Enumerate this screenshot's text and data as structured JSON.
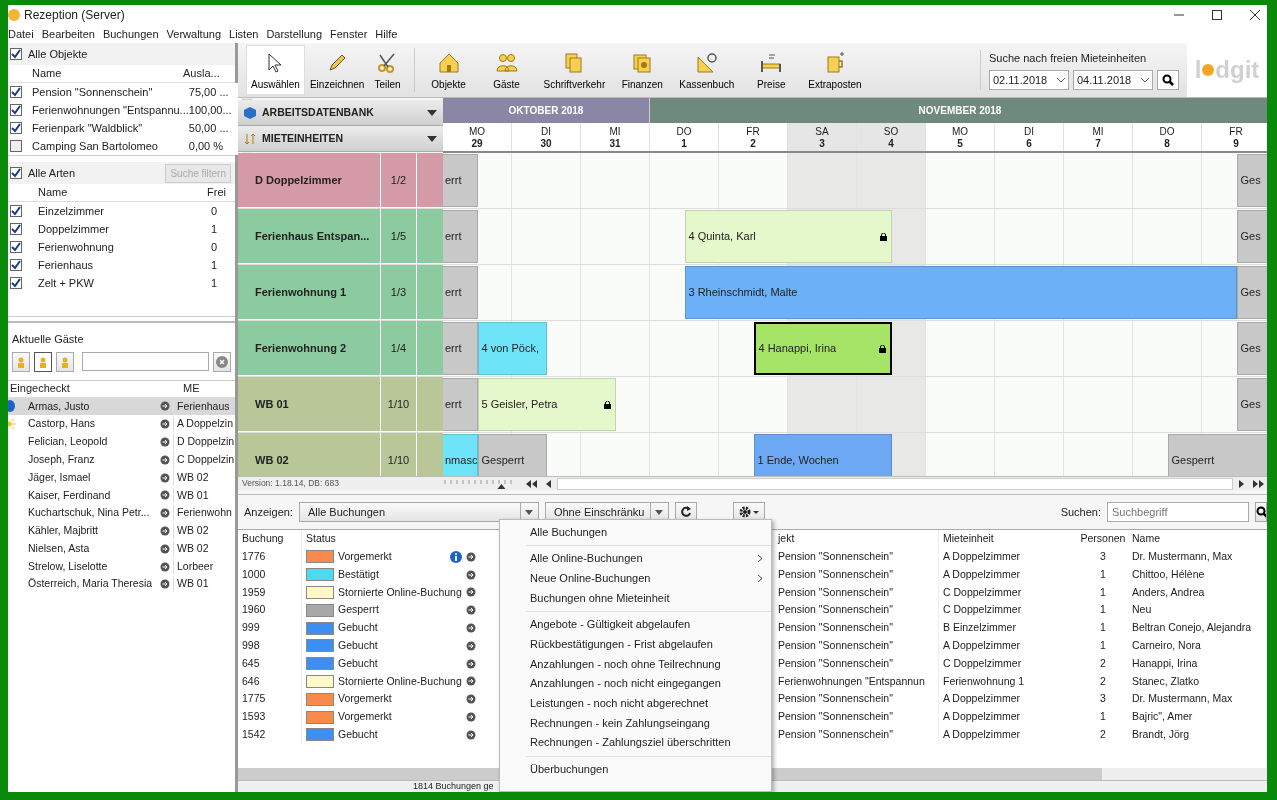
{
  "window": {
    "title": "Rezeption (Server)"
  },
  "menu": [
    "Datei",
    "Bearbeiten",
    "Buchungen",
    "Verwaltung",
    "Listen",
    "Darstellung",
    "Fenster",
    "Hilfe"
  ],
  "objects": {
    "label": "Alle Objekte",
    "checked": true,
    "columns": [
      "Name",
      "Ausla..."
    ],
    "rows": [
      {
        "name": "Pension \"Sonnenschein\"",
        "value": "75,00 ...",
        "checked": true
      },
      {
        "name": "Ferienwohnungen \"Entspannu...",
        "value": "100,00...",
        "checked": true
      },
      {
        "name": "Ferienpark \"Waldblick\"",
        "value": "50,00 ...",
        "checked": true
      },
      {
        "name": "Camping San Bartolomeo",
        "value": "0,00 %",
        "checked": false
      }
    ]
  },
  "types": {
    "label": "Alle Arten",
    "checked": true,
    "filter_button": {
      "label": "Suche filtern",
      "disabled": true
    },
    "columns": [
      "Name",
      "Frei"
    ],
    "rows": [
      {
        "name": "Einzelzimmer",
        "free": "0",
        "checked": true
      },
      {
        "name": "Doppelzimmer",
        "free": "1",
        "checked": true
      },
      {
        "name": "Ferienwohnung",
        "free": "0",
        "checked": true
      },
      {
        "name": "Ferienhaus",
        "free": "1",
        "checked": true
      },
      {
        "name": "Zelt + PKW",
        "free": "1",
        "checked": true
      }
    ]
  },
  "guests": {
    "label": "Aktuelle Gäste",
    "filters": [
      {
        "selected": false
      },
      {
        "selected": true
      },
      {
        "selected": false
      }
    ],
    "columns": [
      "Eingecheckt",
      "ME"
    ],
    "rows": [
      {
        "name": "Armas, Justo",
        "unit": "Ferienhaus",
        "kind": "info",
        "selected": true
      },
      {
        "name": "Castorp, Hans",
        "unit": "A Doppelzin",
        "kind": "new",
        "selected": false
      },
      {
        "name": "Felician, Leopold",
        "unit": "D Doppelzin",
        "kind": "plain",
        "selected": false
      },
      {
        "name": "Joseph, Franz",
        "unit": "C Doppelzin",
        "kind": "plain",
        "selected": false
      },
      {
        "name": "Jäger, Ismael",
        "unit": "WB 02",
        "kind": "plain",
        "selected": false
      },
      {
        "name": "Kaiser, Ferdinand",
        "unit": "WB 01",
        "kind": "plain",
        "selected": false
      },
      {
        "name": "Kuchartschuk, Nina Petr...",
        "unit": "Ferienwohn",
        "kind": "plain",
        "selected": false
      },
      {
        "name": "Kähler, Majbritt",
        "unit": "WB 02",
        "kind": "plain",
        "selected": false
      },
      {
        "name": "Nielsen, Asta",
        "unit": "WB 02",
        "kind": "plain",
        "selected": false
      },
      {
        "name": "Strelow, Liselotte",
        "unit": "Lorbeer",
        "kind": "plain",
        "selected": false
      },
      {
        "name": "Österreich, Maria Theresia",
        "unit": "WB 01",
        "kind": "plain",
        "selected": false
      }
    ]
  },
  "toolbar": {
    "tools": [
      {
        "label": "Auswählen",
        "selected": true
      },
      {
        "label": "Einzeichnen",
        "selected": false
      },
      {
        "label": "Teilen",
        "selected": false
      }
    ],
    "modules": [
      "Objekte",
      "Gäste",
      "Schriftverkehr",
      "Finanzen",
      "Kassenbuch",
      "Preise",
      "Extraposten"
    ],
    "free_search": {
      "label": "Suche nach freien Mieteinheiten",
      "from": "02.11.2018",
      "to": "04.11.2018"
    },
    "logo": [
      "l",
      "dgit"
    ]
  },
  "calendar": {
    "sections": [
      "ARBEITSDATENBANK",
      "MIETEINHEITEN"
    ],
    "months": [
      {
        "label": "OKTOBER 2018",
        "days": [
          {
            "weekday": "MO",
            "day": "29",
            "weekend": false
          },
          {
            "weekday": "DI",
            "day": "30",
            "weekend": false
          },
          {
            "weekday": "MI",
            "day": "31",
            "weekend": false
          }
        ]
      },
      {
        "label": "NOVEMBER 2018",
        "days": [
          {
            "weekday": "DO",
            "day": "1",
            "weekend": false
          },
          {
            "weekday": "FR",
            "day": "2",
            "weekend": false
          },
          {
            "weekday": "SA",
            "day": "3",
            "weekend": true
          },
          {
            "weekday": "SO",
            "day": "4",
            "weekend": true
          },
          {
            "weekday": "MO",
            "day": "5",
            "weekend": false
          },
          {
            "weekday": "DI",
            "day": "6",
            "weekend": false
          },
          {
            "weekday": "MI",
            "day": "7",
            "weekend": false
          },
          {
            "weekday": "DO",
            "day": "8",
            "weekend": false
          },
          {
            "weekday": "FR",
            "day": "9",
            "weekend": false
          }
        ]
      }
    ],
    "units": [
      {
        "name": "D Doppelzimmer",
        "occupancy": "1/2",
        "color": "#d49aa8",
        "slots": [
          {
            "kind": "booking",
            "label": "errt",
            "color": "#c8c8c8",
            "locked": false,
            "selected": false
          },
          {
            "kind": "free"
          },
          {
            "kind": "free"
          },
          {
            "kind": "free"
          },
          {
            "kind": "free"
          },
          {
            "kind": "free"
          },
          {
            "kind": "free"
          },
          {
            "kind": "free"
          },
          {
            "kind": "free"
          },
          {
            "kind": "free"
          },
          {
            "kind": "free"
          },
          {
            "kind": "free"
          },
          {
            "kind": "free"
          },
          {
            "kind": "free"
          },
          {
            "kind": "free"
          },
          {
            "kind": "free"
          },
          {
            "kind": "free"
          },
          {
            "kind": "free"
          },
          {
            "kind": "free"
          },
          {
            "kind": "free"
          },
          {
            "kind": "free"
          },
          {
            "kind": "free"
          },
          {
            "kind": "free"
          },
          {
            "kind": "booking",
            "label": "Ges",
            "color": "#c8c8c8",
            "locked": false,
            "selected": false
          }
        ]
      },
      {
        "name": "Ferienhaus Entspan...",
        "occupancy": "1/5",
        "color": "#8ccba0",
        "slots": [
          {
            "kind": "booking",
            "label": "errt",
            "color": "#c8c8c8",
            "locked": false,
            "selected": false
          },
          {
            "kind": "free"
          },
          {
            "kind": "free"
          },
          {
            "kind": "free"
          },
          {
            "kind": "free"
          },
          {
            "kind": "free"
          },
          {
            "kind": "free"
          },
          {
            "kind": "booking",
            "label": "4 Quinta, Karl",
            "color": "#e4f8cc",
            "locked": true,
            "selected": false
          },
          {
            "kind": "more"
          },
          {
            "kind": "more"
          },
          {
            "kind": "more"
          },
          {
            "kind": "more"
          },
          {
            "kind": "more"
          },
          {
            "kind": "free"
          },
          {
            "kind": "free"
          },
          {
            "kind": "free"
          },
          {
            "kind": "free"
          },
          {
            "kind": "free"
          },
          {
            "kind": "free"
          },
          {
            "kind": "free"
          },
          {
            "kind": "free"
          },
          {
            "kind": "free"
          },
          {
            "kind": "free"
          },
          {
            "kind": "booking",
            "label": "Ges",
            "color": "#c8c8c8",
            "locked": false,
            "selected": false
          }
        ]
      },
      {
        "name": "Ferienwohnung 1",
        "occupancy": "1/3",
        "color": "#8ccba0",
        "slots": [
          {
            "kind": "booking",
            "label": "errt",
            "color": "#c8c8c8",
            "locked": false,
            "selected": false
          },
          {
            "kind": "free"
          },
          {
            "kind": "free"
          },
          {
            "kind": "free"
          },
          {
            "kind": "free"
          },
          {
            "kind": "free"
          },
          {
            "kind": "free"
          },
          {
            "kind": "booking",
            "label": "3 Rheinschmidt, Malte",
            "color": "#6cb0f8",
            "locked": false,
            "selected": false
          },
          {
            "kind": "more"
          },
          {
            "kind": "more"
          },
          {
            "kind": "more"
          },
          {
            "kind": "more"
          },
          {
            "kind": "more"
          },
          {
            "kind": "more"
          },
          {
            "kind": "more"
          },
          {
            "kind": "more"
          },
          {
            "kind": "more"
          },
          {
            "kind": "more"
          },
          {
            "kind": "more"
          },
          {
            "kind": "more"
          },
          {
            "kind": "more"
          },
          {
            "kind": "more"
          },
          {
            "kind": "more"
          },
          {
            "kind": "booking",
            "label": "Ges",
            "color": "#c8c8c8",
            "locked": false,
            "selected": false
          }
        ]
      },
      {
        "name": "Ferienwohnung 2",
        "occupancy": "1/4",
        "color": "#8ccba0",
        "slots": [
          {
            "kind": "booking",
            "label": "errt",
            "color": "#c8c8c8",
            "locked": false,
            "selected": false
          },
          {
            "kind": "booking",
            "label": "4 von Pöck,",
            "color": "#6ee4f8",
            "locked": false,
            "selected": false
          },
          {
            "kind": "more"
          },
          {
            "kind": "free"
          },
          {
            "kind": "free"
          },
          {
            "kind": "free"
          },
          {
            "kind": "free"
          },
          {
            "kind": "free"
          },
          {
            "kind": "free"
          },
          {
            "kind": "booking",
            "label": "4 Hanappi, Irina",
            "color": "#a6e468",
            "locked": true,
            "selected": true
          },
          {
            "kind": "more"
          },
          {
            "kind": "more"
          },
          {
            "kind": "more"
          },
          {
            "kind": "free"
          },
          {
            "kind": "free"
          },
          {
            "kind": "free"
          },
          {
            "kind": "free"
          },
          {
            "kind": "free"
          },
          {
            "kind": "free"
          },
          {
            "kind": "free"
          },
          {
            "kind": "free"
          },
          {
            "kind": "free"
          },
          {
            "kind": "free"
          },
          {
            "kind": "booking",
            "label": "Ges",
            "color": "#c8c8c8",
            "locked": false,
            "selected": false
          }
        ]
      },
      {
        "name": "WB 01",
        "occupancy": "1/10",
        "color": "#b8c698",
        "slots": [
          {
            "kind": "booking",
            "label": "errt",
            "color": "#c8c8c8",
            "locked": false,
            "selected": false
          },
          {
            "kind": "booking",
            "label": "5 Geisler, Petra",
            "color": "#e4f8cc",
            "locked": true,
            "selected": false
          },
          {
            "kind": "more"
          },
          {
            "kind": "more"
          },
          {
            "kind": "more"
          },
          {
            "kind": "free"
          },
          {
            "kind": "free"
          },
          {
            "kind": "free"
          },
          {
            "kind": "free"
          },
          {
            "kind": "free"
          },
          {
            "kind": "free"
          },
          {
            "kind": "free"
          },
          {
            "kind": "free"
          },
          {
            "kind": "free"
          },
          {
            "kind": "free"
          },
          {
            "kind": "free"
          },
          {
            "kind": "free"
          },
          {
            "kind": "free"
          },
          {
            "kind": "free"
          },
          {
            "kind": "free"
          },
          {
            "kind": "free"
          },
          {
            "kind": "free"
          },
          {
            "kind": "free"
          },
          {
            "kind": "booking",
            "label": "Ges",
            "color": "#c8c8c8",
            "locked": false,
            "selected": false
          }
        ]
      },
      {
        "name": "WB 02",
        "occupancy": "1/10",
        "color": "#b8c698",
        "slots": [
          {
            "kind": "booking",
            "label": "nmasc",
            "color": "#6ee4f8",
            "locked": false,
            "selected": false
          },
          {
            "kind": "booking",
            "label": "Gesperrt",
            "color": "#c8c8c8",
            "locked": false,
            "selected": false
          },
          {
            "kind": "more"
          },
          {
            "kind": "free"
          },
          {
            "kind": "free"
          },
          {
            "kind": "free"
          },
          {
            "kind": "free"
          },
          {
            "kind": "free"
          },
          {
            "kind": "free"
          },
          {
            "kind": "booking",
            "label": "1 Ende, Wochen",
            "color": "#6ca8f4",
            "locked": false,
            "selected": false
          },
          {
            "kind": "more"
          },
          {
            "kind": "more"
          },
          {
            "kind": "more"
          },
          {
            "kind": "free"
          },
          {
            "kind": "free"
          },
          {
            "kind": "free"
          },
          {
            "kind": "free"
          },
          {
            "kind": "free"
          },
          {
            "kind": "free"
          },
          {
            "kind": "free"
          },
          {
            "kind": "free"
          },
          {
            "kind": "booking",
            "label": "Gesperrt",
            "color": "#c8c8c8",
            "locked": false,
            "selected": false
          },
          {
            "kind": "more"
          },
          {
            "kind": "more"
          }
        ]
      }
    ],
    "zoom": {
      "level": 0.85
    },
    "version": "Version: 1.18.14, DB: 683"
  },
  "bookings": {
    "show_label": "Anzeigen:",
    "show_value": "Alle Buchungen",
    "restriction": "Ohne Einschränku",
    "search_label": "Suchen:",
    "search": {
      "placeholder": "Suchbegriff"
    },
    "columns": [
      "Buchung",
      "Status",
      "jekt",
      "Mieteinheit",
      "Personen",
      "Name"
    ],
    "rows": [
      {
        "id": "1776",
        "status": "Vorgemerkt",
        "color": "#f78b4a",
        "info": true,
        "object": "Pension \"Sonnenschein\"",
        "unit": "A Doppelzimmer",
        "persons": "3",
        "name": "Dr. Mustermann, Max"
      },
      {
        "id": "1000",
        "status": "Bestätigt",
        "color": "#4fd8f2",
        "info": false,
        "object": "Pension \"Sonnenschein\"",
        "unit": "A Doppelzimmer",
        "persons": "1",
        "name": "Chittoo, Hélène"
      },
      {
        "id": "1959",
        "status": "Stornierte Online-Buchung",
        "color": "#fdf8c6",
        "info": false,
        "object": "Pension \"Sonnenschein\"",
        "unit": "C Doppelzimmer",
        "persons": "1",
        "name": "Anders, Andrea"
      },
      {
        "id": "1960",
        "status": "Gesperrt",
        "color": "#a8a8a8",
        "info": false,
        "object": "Pension \"Sonnenschein\"",
        "unit": "C Doppelzimmer",
        "persons": "1",
        "name": "Neu"
      },
      {
        "id": "999",
        "status": "Gebucht",
        "color": "#3f8ff0",
        "info": false,
        "object": "Pension \"Sonnenschein\"",
        "unit": "B Einzelzimmer",
        "persons": "1",
        "name": "Beltran Conejo, Alejandra"
      },
      {
        "id": "998",
        "status": "Gebucht",
        "color": "#3f8ff0",
        "info": false,
        "object": "Pension \"Sonnenschein\"",
        "unit": "A Doppelzimmer",
        "persons": "1",
        "name": "Carneiro, Nora"
      },
      {
        "id": "645",
        "status": "Gebucht",
        "color": "#3f8ff0",
        "info": false,
        "object": "Pension \"Sonnenschein\"",
        "unit": "C Doppelzimmer",
        "persons": "2",
        "name": "Hanappi, Irina"
      },
      {
        "id": "646",
        "status": "Stornierte Online-Buchung",
        "color": "#fdf8c6",
        "info": false,
        "object": "Ferienwohnungen \"Entspannun",
        "unit": "Ferienwohnung 1",
        "persons": "2",
        "name": "Stanec, Zlatko"
      },
      {
        "id": "1775",
        "status": "Vorgemerkt",
        "color": "#f78b4a",
        "info": false,
        "object": "Pension \"Sonnenschein\"",
        "unit": "A Doppelzimmer",
        "persons": "3",
        "name": "Dr. Mustermann, Max"
      },
      {
        "id": "1593",
        "status": "Vorgemerkt",
        "color": "#f78b4a",
        "info": false,
        "object": "Pension \"Sonnenschein\"",
        "unit": "A Doppelzimmer",
        "persons": "1",
        "name": "Bajric\", Amer"
      },
      {
        "id": "1542",
        "status": "Gebucht",
        "color": "#3f8ff0",
        "info": false,
        "object": "Pension \"Sonnenschein\"",
        "unit": "A Doppelzimmer",
        "persons": "2",
        "name": "Brandt, Jörg"
      }
    ],
    "footer": "1814 Buchungen ge"
  },
  "dropdown": [
    {
      "kind": "item",
      "label": "Alle Buchungen",
      "submenu": false
    },
    {
      "kind": "separator"
    },
    {
      "kind": "item",
      "label": "Alle Online-Buchungen",
      "submenu": true
    },
    {
      "kind": "item",
      "label": "Neue Online-Buchungen",
      "submenu": true
    },
    {
      "kind": "item",
      "label": "Buchungen ohne Mieteinheit",
      "submenu": false
    },
    {
      "kind": "separator"
    },
    {
      "kind": "item",
      "label": "Angebote - Gültigkeit abgelaufen",
      "submenu": false
    },
    {
      "kind": "item",
      "label": "Rückbestätigungen - Frist abgelaufen",
      "submenu": false
    },
    {
      "kind": "item",
      "label": "Anzahlungen - noch ohne Teilrechnung",
      "submenu": false
    },
    {
      "kind": "item",
      "label": "Anzahlungen - noch nicht eingegangen",
      "submenu": false
    },
    {
      "kind": "item",
      "label": "Leistungen - noch nicht abgerechnet",
      "submenu": false
    },
    {
      "kind": "item",
      "label": "Rechnungen - kein Zahlungseingang",
      "submenu": false
    },
    {
      "kind": "item",
      "label": "Rechnungen - Zahlungsziel überschritten",
      "submenu": false
    },
    {
      "kind": "separator"
    },
    {
      "kind": "item",
      "label": "Überbuchungen",
      "submenu": false
    }
  ]
}
